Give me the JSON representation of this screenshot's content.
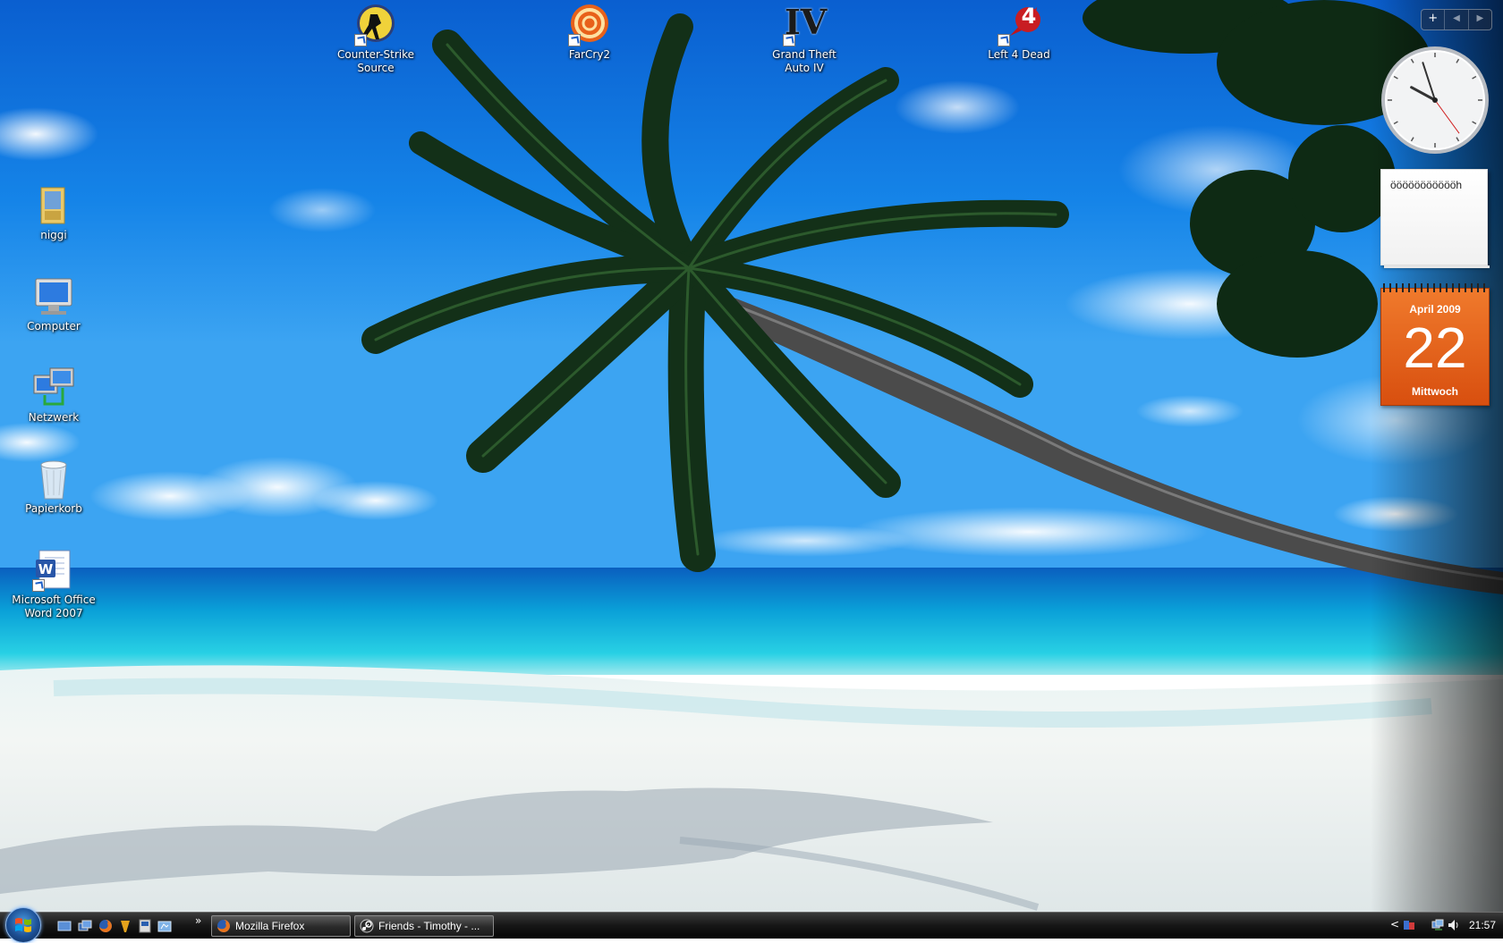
{
  "desktop": {
    "icons": [
      {
        "label": "Counter-Strike Source",
        "icon": "counter-strike-icon",
        "shortcut": true
      },
      {
        "label": "FarCry2",
        "icon": "farcry2-icon",
        "shortcut": true
      },
      {
        "label": "Grand Theft Auto IV",
        "icon": "gta4-icon",
        "shortcut": true
      },
      {
        "label": "Left 4 Dead",
        "icon": "left4dead-icon",
        "shortcut": true
      },
      {
        "label": "niggi",
        "icon": "folder-icon",
        "shortcut": false
      },
      {
        "label": "Computer",
        "icon": "computer-icon",
        "shortcut": false
      },
      {
        "label": "Netzwerk",
        "icon": "network-icon",
        "shortcut": false
      },
      {
        "label": "Papierkorb",
        "icon": "recycle-bin-icon",
        "shortcut": false
      },
      {
        "label": "Microsoft Office\nWord 2007",
        "icon": "word-icon",
        "shortcut": true
      }
    ],
    "gta_logo_text": "IV",
    "l4d_logo_text": "4"
  },
  "sidebar": {
    "add_gadget_label": "+",
    "prev_label": "◀",
    "next_label": "▶",
    "clock": {
      "icon": "analog-clock-icon",
      "hour": 21,
      "minute": 57,
      "second": 24
    },
    "note": {
      "text": "öööööööööööh"
    },
    "calendar": {
      "month_year": "April 2009",
      "day": "22",
      "weekday": "Mittwoch",
      "color": "#e8651f"
    }
  },
  "taskbar": {
    "start_icon": "windows-logo-icon",
    "quick_launch": [
      "show-desktop-icon",
      "switch-windows-icon",
      "firefox-icon",
      "winamp-icon",
      "cmd-icon",
      "explorer-icon"
    ],
    "more_label": "»",
    "tasks": [
      {
        "label": "Mozilla Firefox",
        "icon": "firefox-icon"
      },
      {
        "label": "Friends - Timothy - ...",
        "icon": "steam-icon"
      }
    ],
    "tray": {
      "expand_label": "<",
      "icons": [
        "language-icon",
        "network-tray-icon",
        "volume-icon"
      ],
      "time": "21:57"
    }
  }
}
